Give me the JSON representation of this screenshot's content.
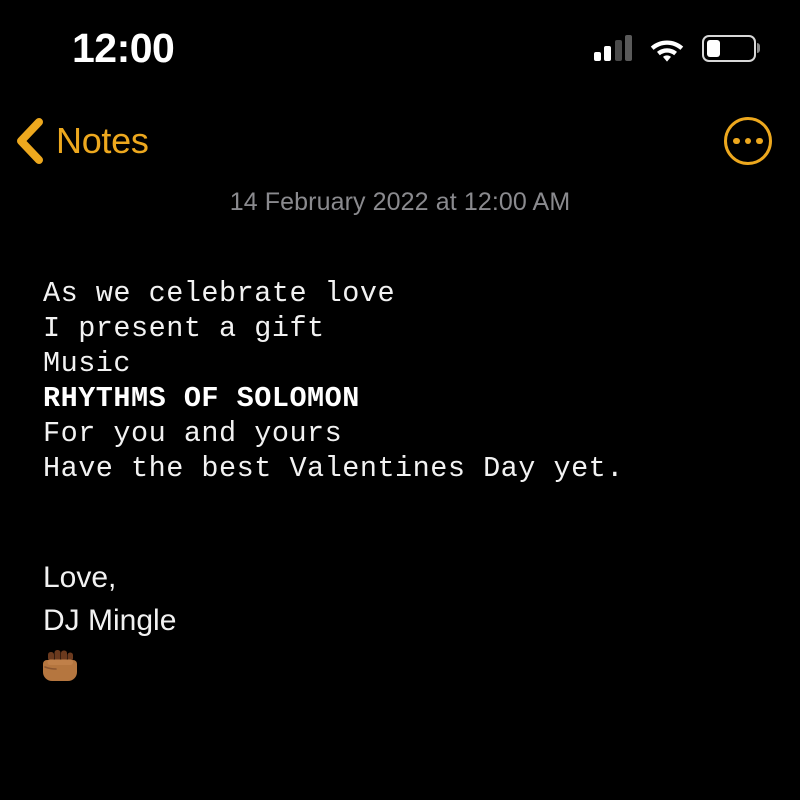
{
  "status_bar": {
    "time": "12:00",
    "signal_icon": "cellular-signal-icon",
    "wifi_icon": "wifi-icon",
    "battery_icon": "battery-icon",
    "battery_level_percent": 25,
    "signal_bars_filled": 2,
    "signal_bars_total": 4
  },
  "nav_bar": {
    "back_icon": "chevron-left-icon",
    "back_label": "Notes",
    "more_icon": "more-options-icon",
    "accent_color": "#EDA81E"
  },
  "note": {
    "date": "14 February 2022 at 12:00 AM",
    "body_lines": [
      {
        "text": "As we celebrate love",
        "bold": false
      },
      {
        "text": "I present a gift",
        "bold": false
      },
      {
        "text": "Music",
        "bold": false
      },
      {
        "text": "RHYTHMS OF SOLOMON",
        "bold": true
      },
      {
        "text": "For you and yours",
        "bold": false
      },
      {
        "text": "Have the best Valentines Day yet.",
        "bold": false
      }
    ],
    "signature_lines": [
      "Love,",
      "DJ Mingle"
    ],
    "signature_emoji": "raised-fist-medium-dark-skin-tone",
    "signature_emoji_glyph": "✊",
    "text_color": "#F2F2F2",
    "date_color": "#8A8A8E",
    "background_color": "#000000"
  }
}
